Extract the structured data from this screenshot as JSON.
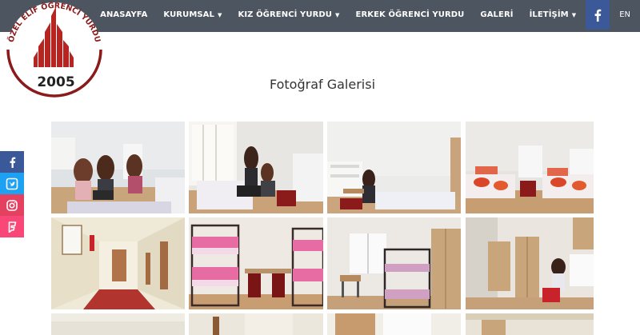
{
  "header": {
    "logo": {
      "text_top": "ÖZEL ELİF ÖĞRENCİ YURDU",
      "year": "2005"
    },
    "nav": [
      {
        "label": "ANASAYFA",
        "dropdown": false
      },
      {
        "label": "KURUMSAL",
        "dropdown": true
      },
      {
        "label": "KIZ ÖĞRENCİ YURDU",
        "dropdown": true
      },
      {
        "label": "ERKEK ÖĞRENCİ YURDU",
        "dropdown": false
      },
      {
        "label": "GALERİ",
        "dropdown": false
      },
      {
        "label": "İLETİŞİM",
        "dropdown": true
      }
    ],
    "facebook_icon": "facebook-icon",
    "language": "EN"
  },
  "main": {
    "title": "Fotoğraf Galerisi"
  },
  "social": [
    {
      "name": "facebook",
      "icon": "facebook-icon",
      "color": "#3b5998"
    },
    {
      "name": "twitter",
      "icon": "twitter-icon",
      "color": "#1da1f2"
    },
    {
      "name": "instagram",
      "icon": "instagram-icon",
      "color": "#e4405f"
    },
    {
      "name": "foursquare",
      "icon": "foursquare-icon",
      "color": "#f94877"
    }
  ],
  "colors": {
    "topbar": "#4d5560",
    "facebook": "#3b5998",
    "logo_red": "#8b1a1a"
  },
  "gallery": {
    "photos": [
      {
        "subject": "students studying at desk in dorm room"
      },
      {
        "subject": "students in dorm room with bunk beds"
      },
      {
        "subject": "student reading at study desk"
      },
      {
        "subject": "dorm room with red floral bedspreads"
      },
      {
        "subject": "hallway corridor with red carpet"
      },
      {
        "subject": "room with bunk beds and pink bedding"
      },
      {
        "subject": "room with bunk beds and wardrobe"
      },
      {
        "subject": "student studying by window"
      },
      {
        "subject": "room detail"
      },
      {
        "subject": "room detail"
      },
      {
        "subject": "room detail"
      },
      {
        "subject": "room detail"
      }
    ]
  }
}
